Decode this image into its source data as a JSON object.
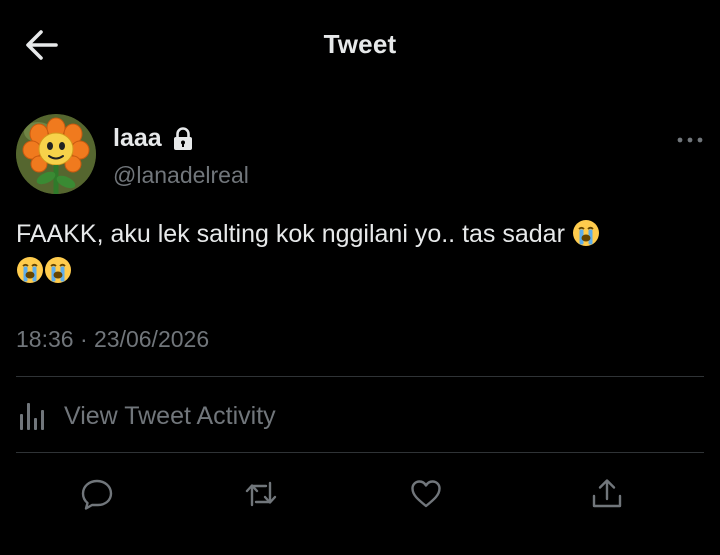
{
  "header": {
    "title": "Tweet",
    "back_icon": "arrow-left-icon"
  },
  "author": {
    "display_name": "laaa",
    "handle": "@lanadelreal",
    "protected": true,
    "avatar": "flower-character-avatar"
  },
  "tweet": {
    "text": "FAAKK, aku lek salting kok nggilani yo.. tas sadar",
    "emojis": [
      "loudly-crying-face",
      "loudly-crying-face",
      "loudly-crying-face"
    ],
    "timestamp": "18:36 · 23/06/2026"
  },
  "activity": {
    "label": "View Tweet Activity",
    "icon": "bar-chart-icon"
  },
  "actions": [
    {
      "name": "reply",
      "icon": "reply-icon"
    },
    {
      "name": "retweet",
      "icon": "retweet-icon"
    },
    {
      "name": "like",
      "icon": "heart-icon"
    },
    {
      "name": "share",
      "icon": "share-icon"
    }
  ],
  "colors": {
    "background": "#000000",
    "text_primary": "#e7e9ea",
    "text_secondary": "#71767b",
    "divider": "#2f3336",
    "emoji_face": "#ffcc4d"
  }
}
